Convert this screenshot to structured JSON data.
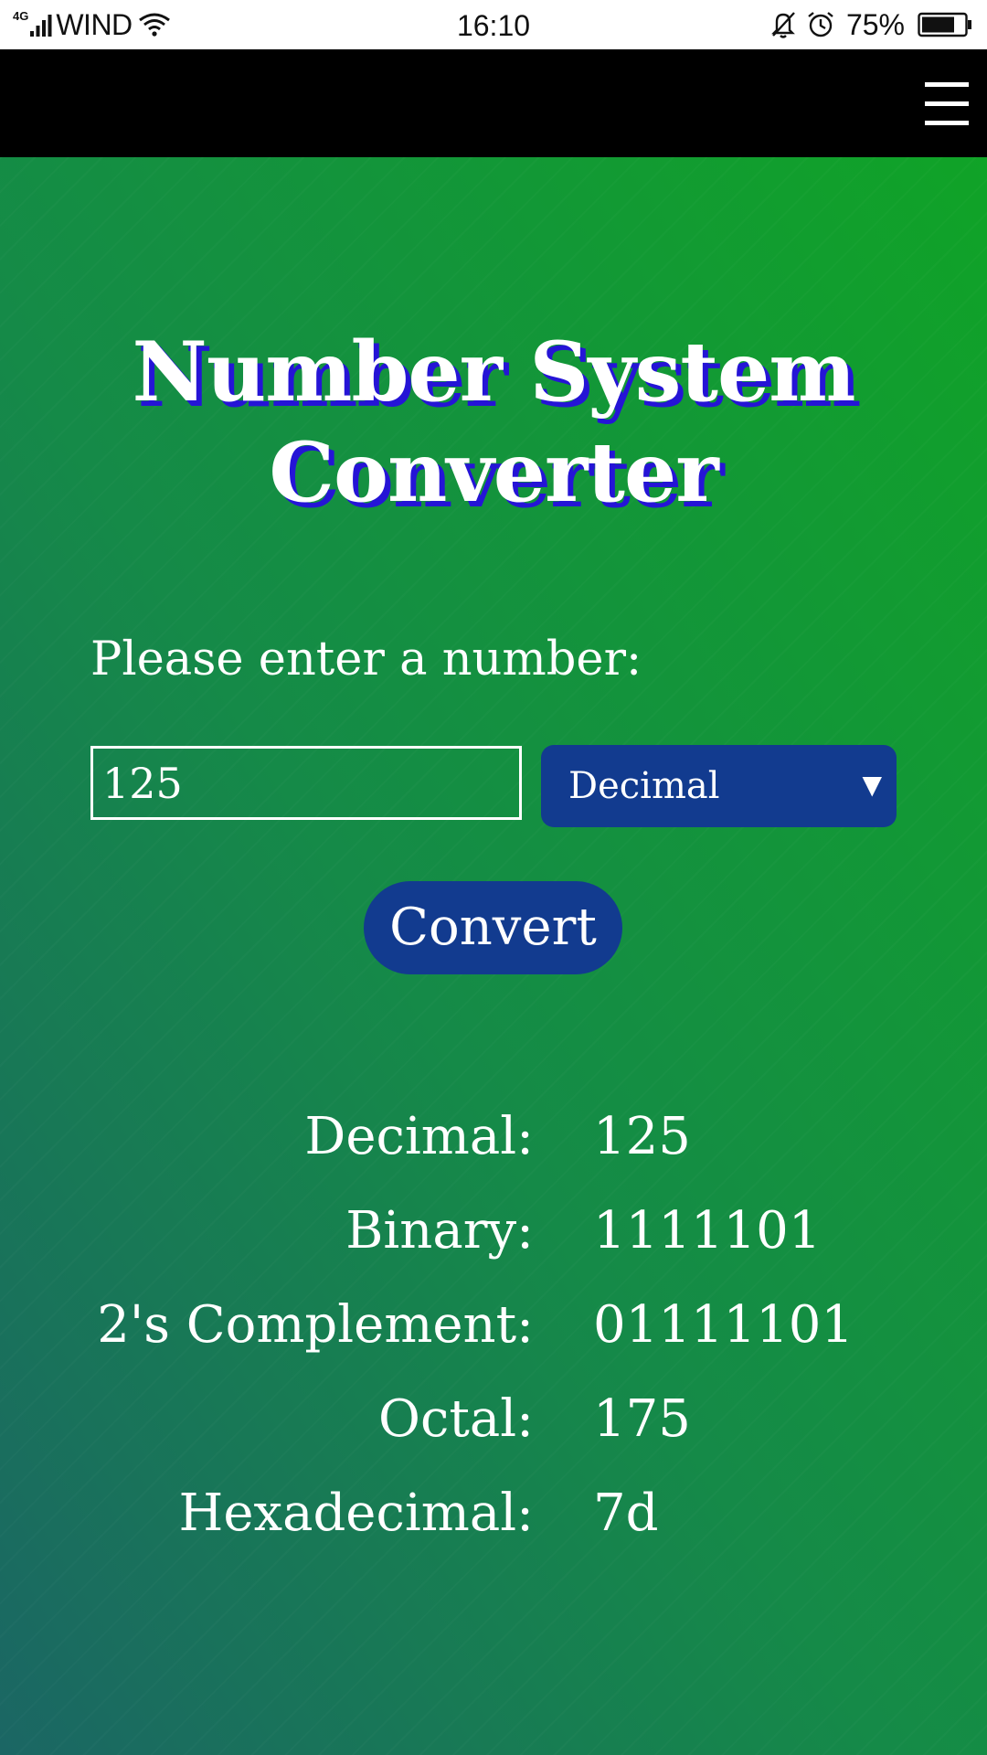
{
  "status_bar": {
    "network": "4G",
    "carrier": "WIND",
    "time": "16:10",
    "battery_percent": "75%",
    "icons": [
      "signal-icon",
      "wifi-icon",
      "mute-bell-icon",
      "alarm-icon",
      "battery-icon"
    ]
  },
  "app_bar": {
    "menu_icon": "hamburger-menu-icon",
    "background": "#000000"
  },
  "main": {
    "title": "Number System Converter",
    "prompt": "Please enter a number:",
    "input_value": "125",
    "base_select": {
      "selected": "Decimal"
    },
    "convert_label": "Convert",
    "results": [
      {
        "label": "Decimal:",
        "value": "125"
      },
      {
        "label": "Binary:",
        "value": "1111101"
      },
      {
        "label": "2's Complement:",
        "value": "01111101"
      },
      {
        "label": "Octal:",
        "value": "175"
      },
      {
        "label": "Hexadecimal:",
        "value": "7d"
      }
    ]
  },
  "colors": {
    "gradient_top": "#10a327",
    "gradient_bottom": "#1b6664",
    "control_blue": "#123b8f",
    "title_shadow": "#2514d6",
    "text": "#ffffff"
  }
}
